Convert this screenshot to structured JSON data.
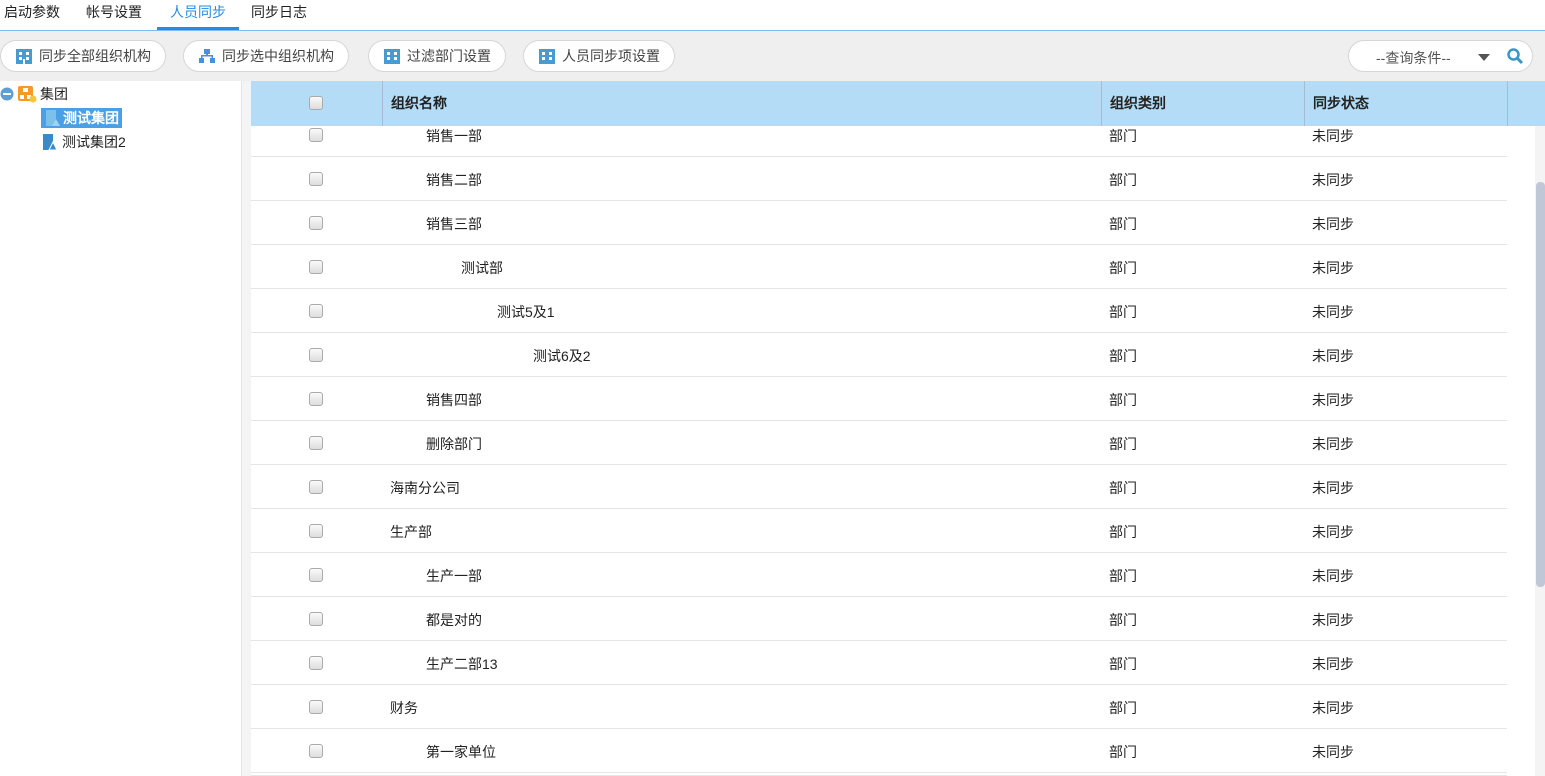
{
  "tabs": [
    {
      "label": "启动参数"
    },
    {
      "label": "帐号设置"
    },
    {
      "label": "人员同步",
      "active": true
    },
    {
      "label": "同步日志"
    }
  ],
  "toolbar": {
    "buttons": [
      {
        "label": "同步全部组织机构",
        "icon": "building-icon"
      },
      {
        "label": "同步选中组织机构",
        "icon": "org-chart-icon"
      },
      {
        "label": "过滤部门设置",
        "icon": "building-icon"
      },
      {
        "label": "人员同步项设置",
        "icon": "building-icon"
      }
    ],
    "query_placeholder": "--查询条件--"
  },
  "tree": {
    "root": "集团",
    "children": [
      {
        "label": "测试集团",
        "selected": true
      },
      {
        "label": "测试集团2"
      }
    ]
  },
  "grid": {
    "headers": {
      "name": "组织名称",
      "type": "组织类别",
      "status": "同步状态"
    },
    "rows": [
      {
        "name": "销售一部",
        "level": 1,
        "type": "部门",
        "status": "未同步"
      },
      {
        "name": "销售二部",
        "level": 1,
        "type": "部门",
        "status": "未同步"
      },
      {
        "name": "销售三部",
        "level": 1,
        "type": "部门",
        "status": "未同步"
      },
      {
        "name": "测试部",
        "level": 2,
        "type": "部门",
        "status": "未同步"
      },
      {
        "name": "测试5及1",
        "level": 3,
        "type": "部门",
        "status": "未同步"
      },
      {
        "name": "测试6及2",
        "level": 4,
        "type": "部门",
        "status": "未同步"
      },
      {
        "name": "销售四部",
        "level": 1,
        "type": "部门",
        "status": "未同步"
      },
      {
        "name": "删除部门",
        "level": 1,
        "type": "部门",
        "status": "未同步"
      },
      {
        "name": "海南分公司",
        "level": 0,
        "type": "部门",
        "status": "未同步"
      },
      {
        "name": "生产部",
        "level": 0,
        "type": "部门",
        "status": "未同步"
      },
      {
        "name": "生产一部",
        "level": 1,
        "type": "部门",
        "status": "未同步"
      },
      {
        "name": "都是对的",
        "level": 1,
        "type": "部门",
        "status": "未同步"
      },
      {
        "name": "生产二部13",
        "level": 1,
        "type": "部门",
        "status": "未同步"
      },
      {
        "name": "财务",
        "level": 0,
        "type": "部门",
        "status": "未同步"
      },
      {
        "name": "第一家单位",
        "level": 1,
        "type": "部门",
        "status": "未同步"
      },
      {
        "name": "",
        "level": 1,
        "type": "",
        "status": ""
      }
    ]
  },
  "colors": {
    "accent": "#2a8ae0",
    "header_bg": "#b4dcf6",
    "selected": "#4aa0e6"
  }
}
